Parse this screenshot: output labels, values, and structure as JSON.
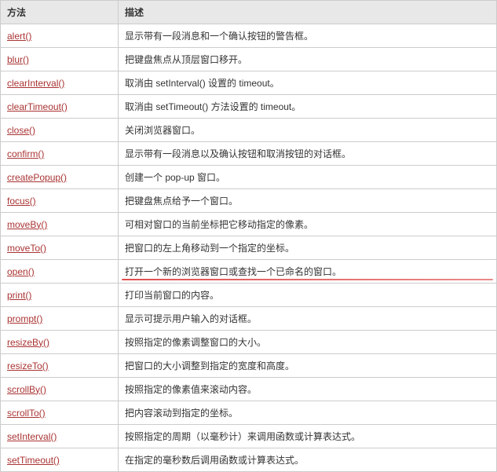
{
  "headers": {
    "method": "方法",
    "description": "描述"
  },
  "rows": [
    {
      "method": "alert()",
      "description": "显示带有一段消息和一个确认按钮的警告框。"
    },
    {
      "method": "blur()",
      "description": "把键盘焦点从顶层窗口移开。"
    },
    {
      "method": "clearInterval()",
      "description": "取消由 setInterval() 设置的 timeout。"
    },
    {
      "method": "clearTimeout()",
      "description": "取消由 setTimeout() 方法设置的 timeout。"
    },
    {
      "method": "close()",
      "description": "关闭浏览器窗口。"
    },
    {
      "method": "confirm()",
      "description": "显示带有一段消息以及确认按钮和取消按钮的对话框。"
    },
    {
      "method": "createPopup()",
      "description": "创建一个 pop-up 窗口。"
    },
    {
      "method": "focus()",
      "description": "把键盘焦点给予一个窗口。"
    },
    {
      "method": "moveBy()",
      "description": "可相对窗口的当前坐标把它移动指定的像素。"
    },
    {
      "method": "moveTo()",
      "description": "把窗口的左上角移动到一个指定的坐标。"
    },
    {
      "method": "open()",
      "description": "打开一个新的浏览器窗口或查找一个已命名的窗口。",
      "highlighted": true
    },
    {
      "method": "print()",
      "description": "打印当前窗口的内容。"
    },
    {
      "method": "prompt()",
      "description": "显示可提示用户输入的对话框。"
    },
    {
      "method": "resizeBy()",
      "description": "按照指定的像素调整窗口的大小。"
    },
    {
      "method": "resizeTo()",
      "description": "把窗口的大小调整到指定的宽度和高度。"
    },
    {
      "method": "scrollBy()",
      "description": "按照指定的像素值来滚动内容。"
    },
    {
      "method": "scrollTo()",
      "description": "把内容滚动到指定的坐标。"
    },
    {
      "method": "setInterval()",
      "description": "按照指定的周期（以毫秒计）来调用函数或计算表达式。"
    },
    {
      "method": "setTimeout()",
      "description": "在指定的毫秒数后调用函数或计算表达式。"
    }
  ]
}
